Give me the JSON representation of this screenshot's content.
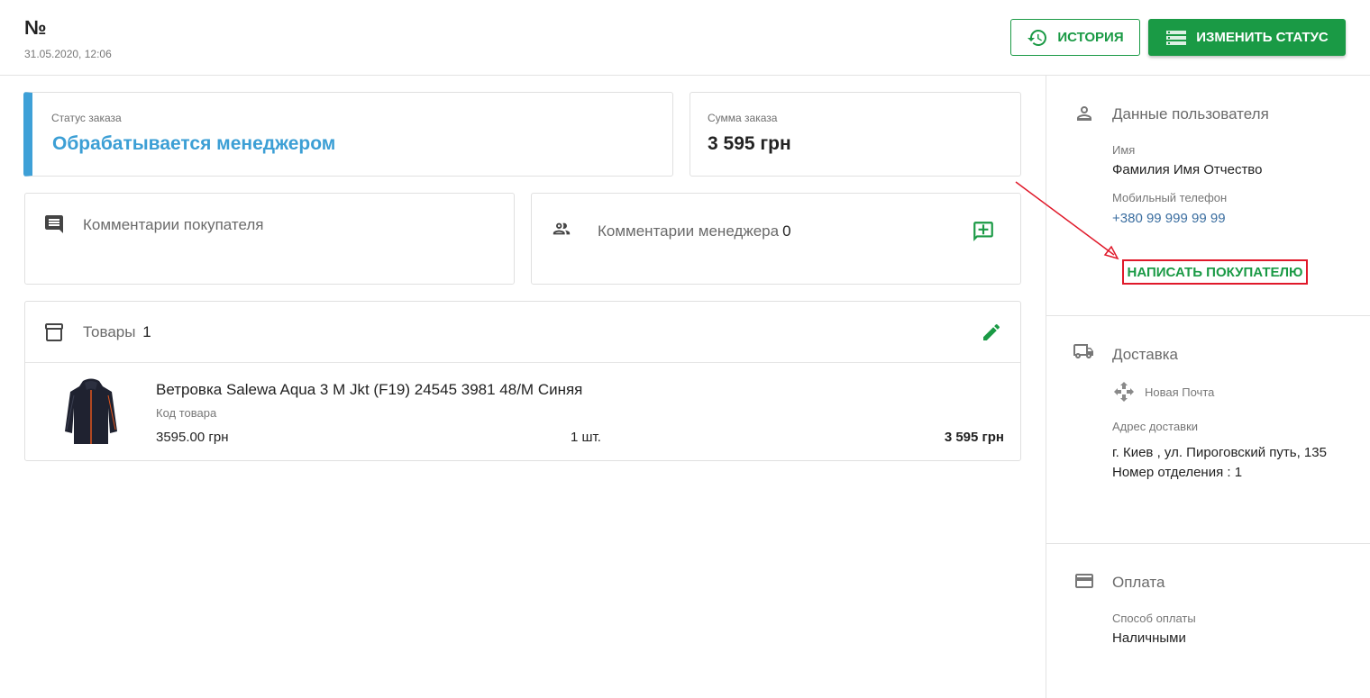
{
  "header": {
    "order_no": "№",
    "date": "31.05.2020, 12:06",
    "history_label": "ИСТОРИЯ",
    "change_status_label": "ИЗМЕНИТЬ СТАТУС"
  },
  "status": {
    "label": "Статус заказа",
    "value": "Обрабатывается менеджером",
    "color": "#3ea0d7"
  },
  "sum": {
    "label": "Сумма заказа",
    "value": "3 595 грн"
  },
  "comments": {
    "buyer_title": "Комментарии покупателя",
    "manager_title": "Комментарии менеджера",
    "manager_count": "0"
  },
  "goods": {
    "title": "Товары",
    "count": "1",
    "items": [
      {
        "name": "Ветровка Salewa Aqua 3 M Jkt (F19) 24545 3981 48/M Синяя",
        "code_label": "Код товара",
        "price": "3595.00 грн",
        "qty": "1 шт.",
        "total": "3 595 грн"
      }
    ]
  },
  "sidebar": {
    "user": {
      "title": "Данные пользователя",
      "name_label": "Имя",
      "name_value": "Фамилия Имя Отчество",
      "phone_label": "Мобильный телефон",
      "phone_value": "+380 99 999 99 99",
      "write_label": "НАПИСАТЬ ПОКУПАТЕЛЮ"
    },
    "delivery": {
      "title": "Доставка",
      "carrier": "Новая Почта",
      "address_label": "Адрес доставки",
      "address_line1": "г. Киев , ул. Пироговский путь, 135",
      "address_line2": "Номер отделения : 1"
    },
    "payment": {
      "title": "Оплата",
      "method_label": "Способ оплаты",
      "method_value": "Наличными"
    }
  },
  "colors": {
    "accent_green": "#1a9a45",
    "status_blue": "#3c9fd5",
    "annotation_red": "#e0192a"
  }
}
